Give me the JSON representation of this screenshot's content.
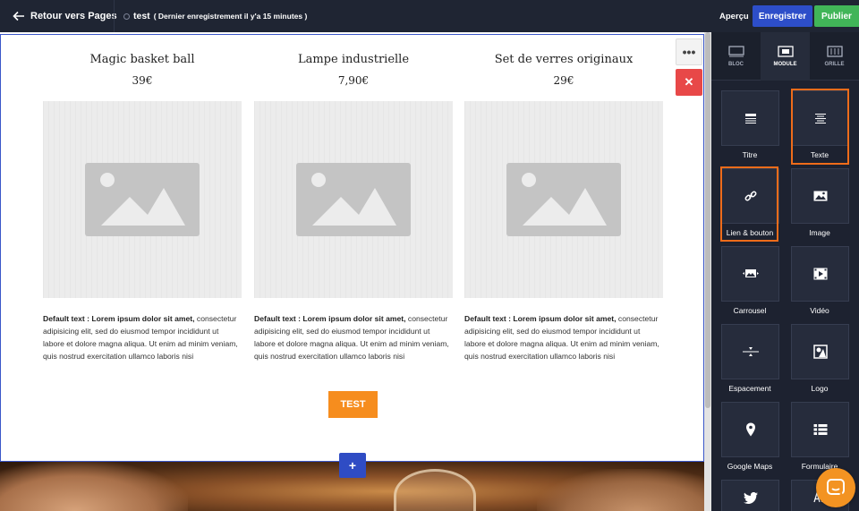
{
  "topbar": {
    "back_label": "Retour vers Pages",
    "doc_name": "test",
    "doc_status": "( Dernier enregistrement il y'a 15 minutes )",
    "preview_label": "Aperçu",
    "save_label": "Enregistrer",
    "publish_label": "Publier"
  },
  "products": [
    {
      "name": "Magic basket ball",
      "price": "39€",
      "desc_bold": "Default text : Lorem ipsum dolor sit amet,",
      "desc": "consectetur adipisicing elit, sed do eiusmod tempor incididunt ut labore et dolore magna aliqua. Ut enim ad minim veniam, quis nostrud exercitation ullamco laboris nisi"
    },
    {
      "name": "Lampe industrielle",
      "price": "7,90€",
      "desc_bold": "Default text : Lorem ipsum dolor sit amet,",
      "desc": "consectetur adipisicing elit, sed do eiusmod tempor incididunt ut labore et dolore magna aliqua. Ut enim ad minim veniam, quis nostrud exercitation ullamco laboris nisi"
    },
    {
      "name": "Set de verres originaux",
      "price": "29€",
      "desc_bold": "Default text : Lorem ipsum dolor sit amet,",
      "desc": "consectetur adipisicing elit, sed do eiusmod tempor incididunt ut labore et dolore magna aliqua. Ut enim ad minim veniam, quis nostrud exercitation ullamco laboris nisi"
    }
  ],
  "cta": {
    "label": "TEST"
  },
  "section_tools": {
    "more": "•••",
    "close": "✕",
    "add": "+"
  },
  "panel": {
    "tabs": [
      {
        "label": "BLOC",
        "icon": "block-icon"
      },
      {
        "label": "MODULE",
        "icon": "module-icon",
        "active": true
      },
      {
        "label": "GRILLE",
        "icon": "grid-icon"
      }
    ],
    "modules": [
      {
        "label": "Titre",
        "icon": "title-icon"
      },
      {
        "label": "Texte",
        "icon": "text-icon",
        "highlighted": true
      },
      {
        "label": "Lien & bouton",
        "icon": "link-icon",
        "highlighted": true
      },
      {
        "label": "Image",
        "icon": "image-icon"
      },
      {
        "label": "Carrousel",
        "icon": "carousel-icon"
      },
      {
        "label": "Vidéo",
        "icon": "video-icon"
      },
      {
        "label": "Espacement",
        "icon": "spacing-icon"
      },
      {
        "label": "Logo",
        "icon": "logo-icon"
      },
      {
        "label": "Google Maps",
        "icon": "map-pin-icon"
      },
      {
        "label": "Formulaire",
        "icon": "form-icon"
      },
      {
        "label": "",
        "icon": "twitter-icon"
      },
      {
        "label": "",
        "icon": "font-icon"
      }
    ],
    "highlight_color": "#ef6c1a"
  },
  "colors": {
    "topbar_bg": "#1f2533",
    "save_btn": "#2d4ec9",
    "publish_btn": "#41b558",
    "cta_btn": "#f68d1e",
    "close_btn": "#e84848",
    "panel_bg": "#1d2230"
  }
}
